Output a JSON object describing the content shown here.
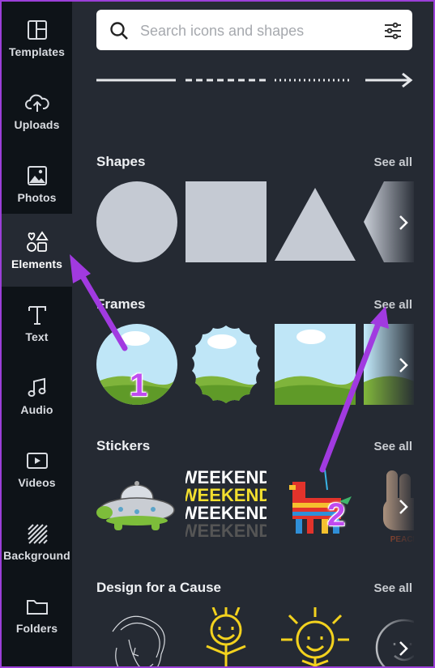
{
  "rail": {
    "items": [
      {
        "label": "Templates",
        "icon": "templates-icon"
      },
      {
        "label": "Uploads",
        "icon": "upload-cloud-icon"
      },
      {
        "label": "Photos",
        "icon": "photo-icon"
      },
      {
        "label": "Elements",
        "icon": "elements-icon",
        "active": true
      },
      {
        "label": "Text",
        "icon": "text-icon"
      },
      {
        "label": "Audio",
        "icon": "music-note-icon"
      },
      {
        "label": "Videos",
        "icon": "video-icon"
      },
      {
        "label": "Background",
        "icon": "background-pattern-icon"
      },
      {
        "label": "Folders",
        "icon": "folder-icon"
      }
    ]
  },
  "search": {
    "placeholder": "Search icons and shapes"
  },
  "sections": {
    "shapes": {
      "title": "Shapes",
      "see_all": "See all"
    },
    "frames": {
      "title": "Frames",
      "see_all": "See all"
    },
    "stickers": {
      "title": "Stickers",
      "see_all": "See all"
    },
    "cause": {
      "title": "Design for a Cause",
      "see_all": "See all"
    }
  },
  "stickers": {
    "word_text": "WEEKEND",
    "peace_text": "PEACE"
  },
  "annotations": {
    "marker_1": "1",
    "marker_2": "2"
  },
  "colors": {
    "accent": "#9b3fd8",
    "panel_bg": "#252a33",
    "rail_bg": "#0e1318",
    "shape_fill": "#c5cad3"
  }
}
